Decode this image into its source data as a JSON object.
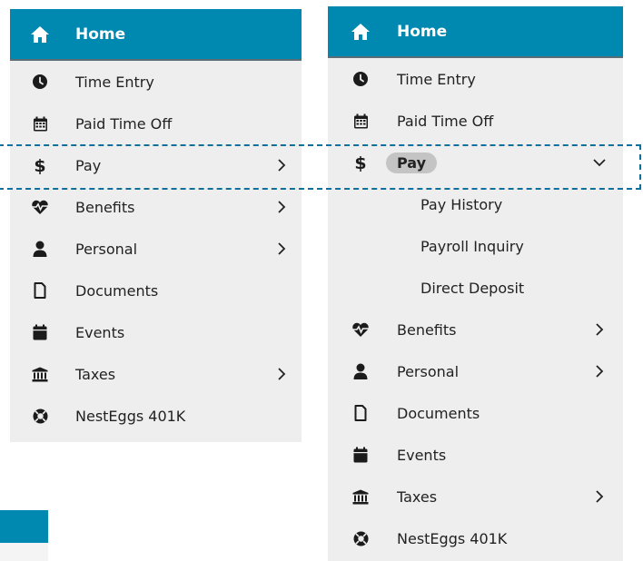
{
  "colors": {
    "header_bg": "#0089b0",
    "menu_bg": "#eeeeee",
    "pill_bg": "#c4c4c4",
    "highlight": "#0c6f9c"
  },
  "collapsed_menu": {
    "home": {
      "label": "Home",
      "icon": "home-icon"
    },
    "items": [
      {
        "label": "Time Entry",
        "icon": "clock-icon",
        "chevron": false
      },
      {
        "label": "Paid Time Off",
        "icon": "calendar-icon",
        "chevron": false
      },
      {
        "label": "Pay",
        "icon": "dollar-icon",
        "chevron": "right"
      },
      {
        "label": "Benefits",
        "icon": "heartbeat-icon",
        "chevron": "right"
      },
      {
        "label": "Personal",
        "icon": "user-icon",
        "chevron": "right"
      },
      {
        "label": "Documents",
        "icon": "document-icon",
        "chevron": false
      },
      {
        "label": "Events",
        "icon": "calendar-icon",
        "chevron": false
      },
      {
        "label": "Taxes",
        "icon": "bank-icon",
        "chevron": "right"
      },
      {
        "label": "NestEggs 401K",
        "icon": "lifebuoy-icon",
        "chevron": false
      }
    ]
  },
  "expanded_menu": {
    "home": {
      "label": "Home",
      "icon": "home-icon"
    },
    "items": [
      {
        "label": "Time Entry",
        "icon": "clock-icon",
        "chevron": false
      },
      {
        "label": "Paid Time Off",
        "icon": "calendar-icon",
        "chevron": false
      },
      {
        "label": "Pay",
        "icon": "dollar-icon",
        "chevron": "down",
        "active": true
      },
      {
        "label": "Pay History",
        "sub": true
      },
      {
        "label": "Payroll Inquiry",
        "sub": true
      },
      {
        "label": "Direct Deposit",
        "sub": true
      },
      {
        "label": "Benefits",
        "icon": "heartbeat-icon",
        "chevron": "right"
      },
      {
        "label": "Personal",
        "icon": "user-icon",
        "chevron": "right"
      },
      {
        "label": "Documents",
        "icon": "document-icon",
        "chevron": false
      },
      {
        "label": "Events",
        "icon": "calendar-icon",
        "chevron": false
      },
      {
        "label": "Taxes",
        "icon": "bank-icon",
        "chevron": "right"
      },
      {
        "label": "NestEggs 401K",
        "icon": "lifebuoy-icon",
        "chevron": false
      }
    ]
  }
}
